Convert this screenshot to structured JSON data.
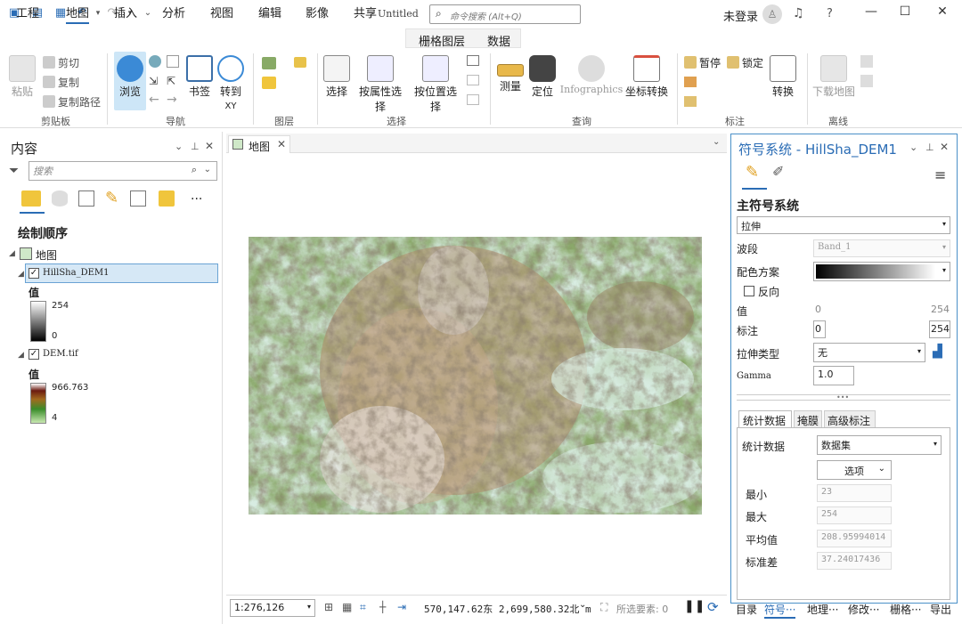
{
  "titlebar": {
    "title": "Untitled",
    "search_placeholder": "命令搜索 (Alt+Q)",
    "user": "未登录",
    "help": "?"
  },
  "tabs": [
    "工程",
    "地图",
    "插入",
    "分析",
    "视图",
    "编辑",
    "影像",
    "共享"
  ],
  "context_tabs": [
    "栅格图层",
    "数据"
  ],
  "ribbon": {
    "clipboard": {
      "paste": "粘贴",
      "cut": "剪切",
      "copy": "复制",
      "copy_path": "复制路径",
      "label": "剪贴板"
    },
    "navigate": {
      "explore": "浏览",
      "bookmark": "书签",
      "goto_xy_top": "转到",
      "goto_xy_bottom": "XY",
      "label": "导航"
    },
    "layer": {
      "label": "图层"
    },
    "selection": {
      "select": "选择",
      "by_attr": "按属性选择",
      "by_loc": "按位置选择",
      "label": "选择"
    },
    "inquiry": {
      "measure": "测量",
      "locate": "定位",
      "infographics": "Infographics",
      "coord": "坐标转换",
      "label": "查询"
    },
    "labeling": {
      "pause": "暂停",
      "lock": "锁定",
      "convert": "转换",
      "label": "标注"
    },
    "offline": {
      "download": "下载地图",
      "label": "离线"
    }
  },
  "contents": {
    "title": "内容",
    "search_placeholder": "搜索",
    "draw_order": "绘制顺序",
    "map": "地图",
    "layers": [
      {
        "name": "HillSha_DEM1",
        "legend_title": "值",
        "max": "254",
        "min": "0"
      },
      {
        "name": "DEM.tif",
        "legend_title": "值",
        "max": "966.763",
        "min": "4"
      }
    ]
  },
  "map_tab": "地图",
  "statusbar": {
    "scale": "1:276,126",
    "coords": "570,147.62东 2,699,580.32北 m",
    "selected": "所选要素: 0"
  },
  "symbology": {
    "title": "符号系统 - HillSha_DEM1",
    "primary": "主符号系统",
    "renderer": "拉伸",
    "band_label": "波段",
    "band": "Band_1",
    "ramp_label": "配色方案",
    "invert": "反向",
    "value_label": "值",
    "value_min": "0",
    "value_max": "254",
    "labels_label": "标注",
    "label_min": "0",
    "label_max": "254",
    "stretch_type_label": "拉伸类型",
    "stretch_type": "无",
    "gamma_label": "Gamma",
    "gamma": "1.0",
    "subtabs": [
      "统计数据",
      "掩膜",
      "高级标注"
    ],
    "stats_label": "统计数据",
    "stats_source": "数据集",
    "options": "选项",
    "min_label": "最小",
    "min": "23",
    "max_label": "最大",
    "max": "254",
    "mean_label": "平均值",
    "mean": "208.95994014",
    "std_label": "标准差",
    "std": "37.24017436"
  },
  "bottom_tabs": [
    "目录",
    "符号···",
    "地理···",
    "修改···",
    "栅格···",
    "导出"
  ]
}
